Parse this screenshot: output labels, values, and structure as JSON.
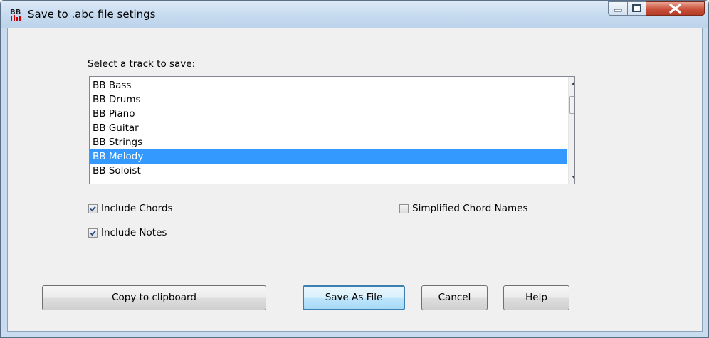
{
  "window": {
    "title": "Save to .abc file setings",
    "app_icon_text": "BB",
    "caption_buttons": [
      "minimize",
      "maximize",
      "close"
    ]
  },
  "track_select": {
    "label": "Select a track to save:",
    "items": [
      "BB Bass",
      "BB Drums",
      "BB Piano",
      "BB Guitar",
      "BB Strings",
      "BB Melody",
      "BB Soloist"
    ],
    "selected": "BB Melody"
  },
  "options": {
    "include_chords": {
      "label": "Include Chords",
      "checked": true
    },
    "include_notes": {
      "label": "Include Notes",
      "checked": true
    },
    "simplified_chord_names": {
      "label": "Simplified Chord Names",
      "checked": false
    }
  },
  "buttons": {
    "copy": "Copy to clipboard",
    "save": "Save As File",
    "cancel": "Cancel",
    "help": "Help"
  },
  "colors": {
    "selection": "#3399ff",
    "titlebar": "#c8dcf0",
    "close_button": "#c9503a",
    "dialog_bg": "#f0f0f0"
  }
}
